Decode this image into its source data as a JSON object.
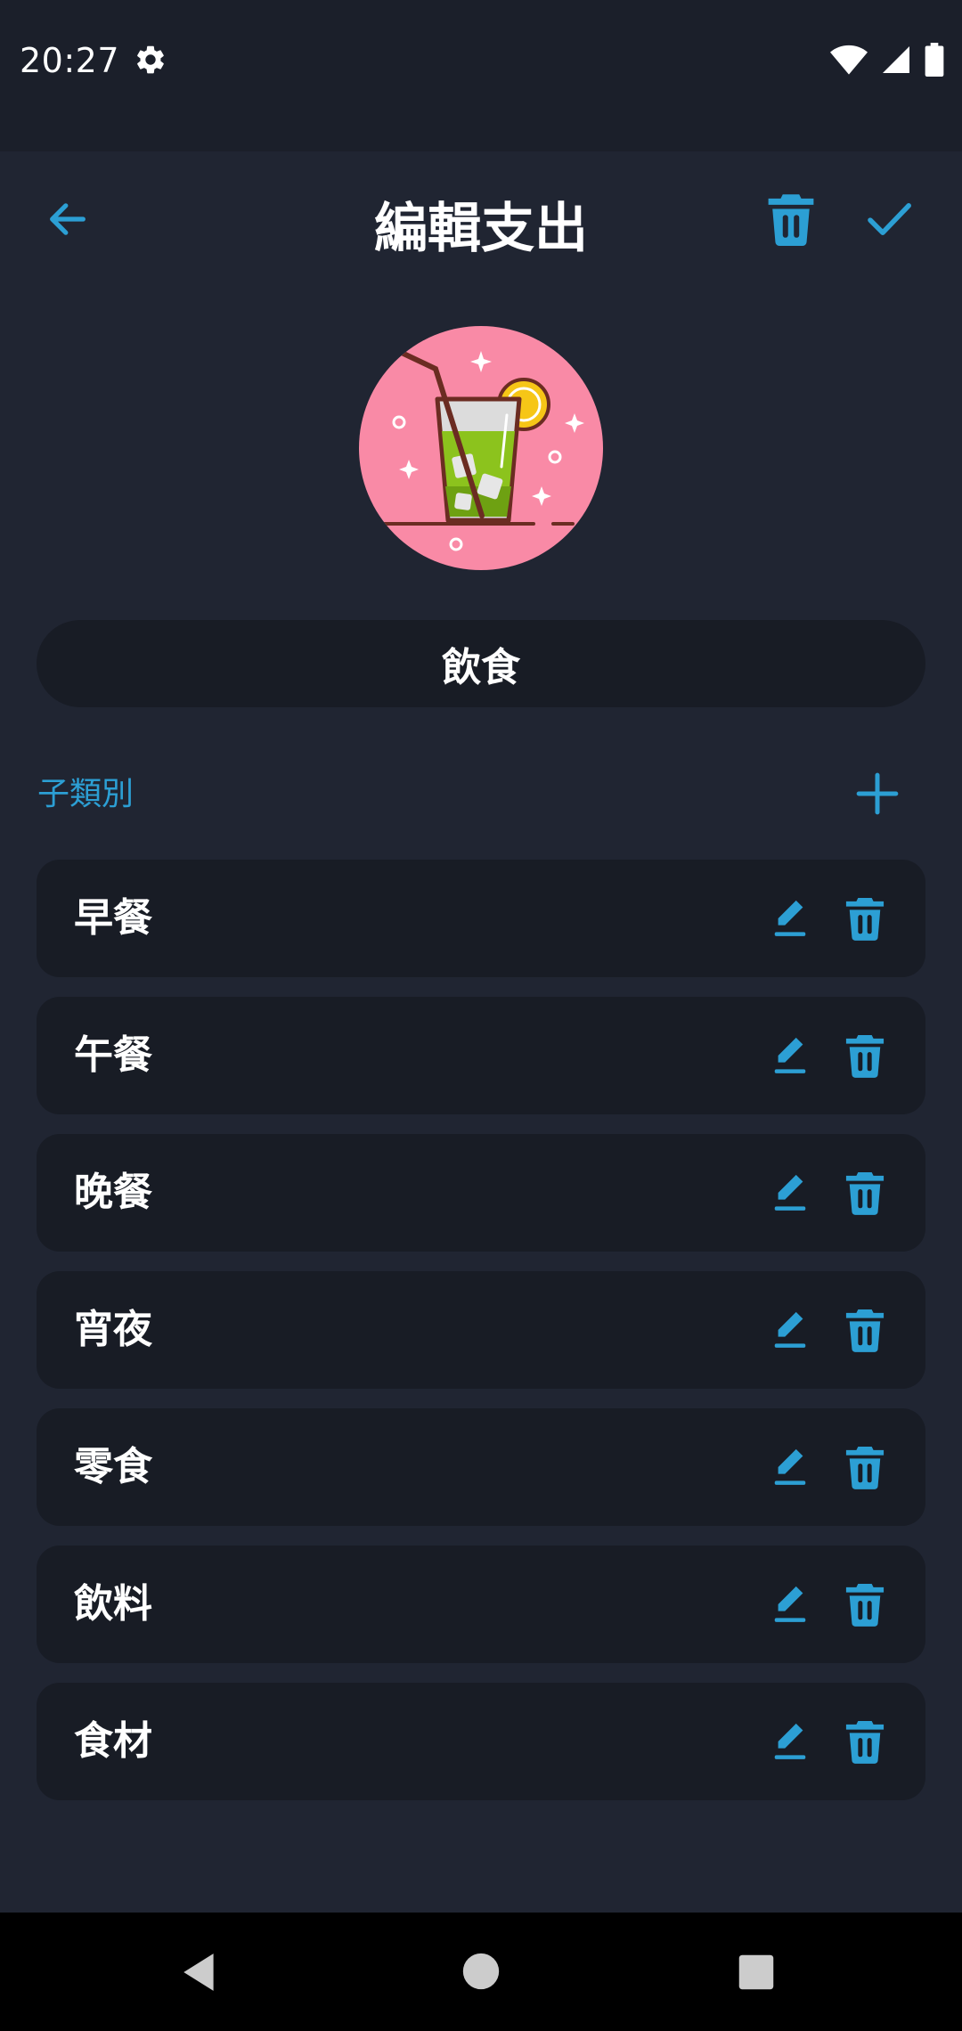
{
  "status_bar": {
    "time": "20:27"
  },
  "header": {
    "title": "編輯支出"
  },
  "category": {
    "name": "飲食",
    "icon": "drink-glass-icon"
  },
  "subcategories": {
    "label": "子類別",
    "items": [
      {
        "label": "早餐"
      },
      {
        "label": "午餐"
      },
      {
        "label": "晚餐"
      },
      {
        "label": "宵夜"
      },
      {
        "label": "零食"
      },
      {
        "label": "飲料"
      },
      {
        "label": "食材"
      }
    ]
  },
  "colors": {
    "accent": "#2c9fd4",
    "background": "#202532",
    "card": "#181c25",
    "icon_bg": "#f98aa6"
  }
}
